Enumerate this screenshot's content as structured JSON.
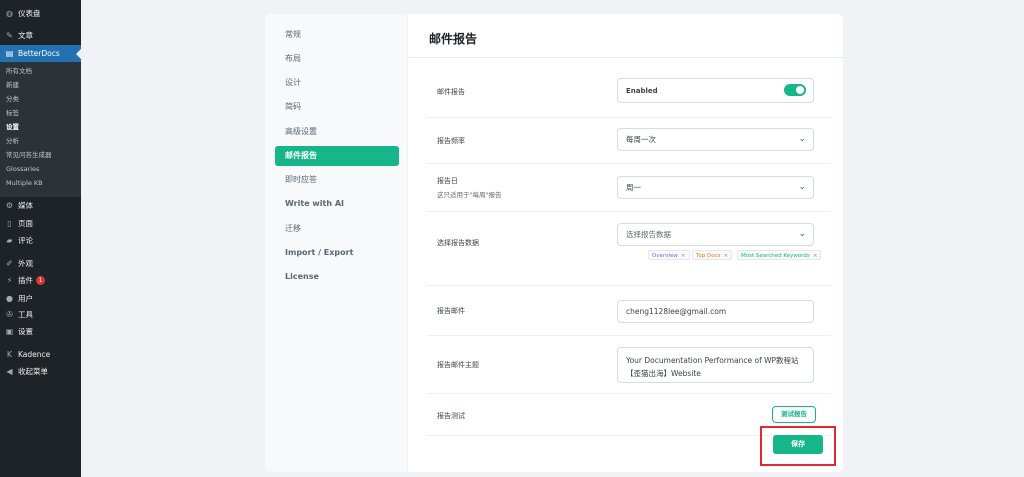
{
  "wp_sidebar": {
    "dashboard": "仪表盘",
    "posts": "文章",
    "betterdocs": "BetterDocs",
    "submenu": [
      "所有文档",
      "新建",
      "分类",
      "标签",
      "设置",
      "分析",
      "常见问答生成器",
      "Glossaries",
      "Multiple KB"
    ],
    "media": "媒体",
    "pages": "页面",
    "comments": "评论",
    "appearance": "外观",
    "plugins": "插件",
    "plugins_badge": "1",
    "users": "用户",
    "tools": "工具",
    "settings": "设置",
    "kadence": "Kadence",
    "collapse": "收起菜单"
  },
  "settings_nav": {
    "items": [
      "常规",
      "布局",
      "设计",
      "简码",
      "高级设置",
      "邮件报告",
      "即时应答",
      "Write with AI",
      "迁移",
      "Import / Export",
      "License"
    ],
    "active": "邮件报告"
  },
  "page": {
    "title": "邮件报告",
    "report_enable": {
      "label": "邮件报告",
      "value": "Enabled",
      "enabled": true
    },
    "frequency": {
      "label": "报告频率",
      "value": "每周一次"
    },
    "day": {
      "label": "报告日",
      "hint": "这只适用于\"每周\"报告",
      "value": "周一"
    },
    "data": {
      "label": "选择报告数据",
      "placeholder": "选择报告数据",
      "tags": [
        {
          "label": "Overview",
          "color": "#7b61ff"
        },
        {
          "label": "Top Docs",
          "color": "#e8762c"
        },
        {
          "label": "Most Searched Keywords",
          "color": "#16b68a"
        }
      ],
      "remove": "×"
    },
    "email": {
      "label": "报告邮件",
      "value": "cheng1128lee@gmail.com"
    },
    "subject": {
      "label": "报告邮件主题",
      "value": "Your Documentation Performance of WP教程站【歪猫出海】Website"
    },
    "test": {
      "label": "报告测试",
      "button": "测试报告"
    },
    "save": "保存"
  },
  "colors": {
    "accent": "#16b68a",
    "wp_active": "#2271b1",
    "highlight": "#e0282e"
  }
}
